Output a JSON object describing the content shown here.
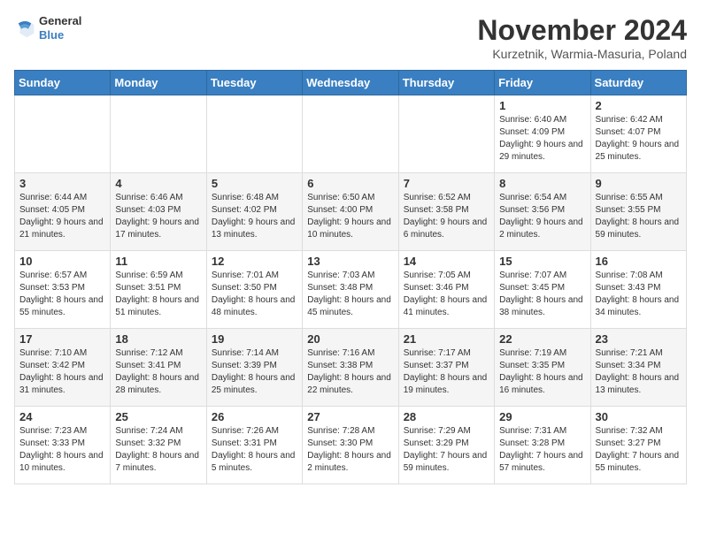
{
  "logo": {
    "line1": "General",
    "line2": "Blue"
  },
  "title": "November 2024",
  "location": "Kurzetnik, Warmia-Masuria, Poland",
  "weekdays": [
    "Sunday",
    "Monday",
    "Tuesday",
    "Wednesday",
    "Thursday",
    "Friday",
    "Saturday"
  ],
  "weeks": [
    [
      {
        "day": "",
        "info": ""
      },
      {
        "day": "",
        "info": ""
      },
      {
        "day": "",
        "info": ""
      },
      {
        "day": "",
        "info": ""
      },
      {
        "day": "",
        "info": ""
      },
      {
        "day": "1",
        "info": "Sunrise: 6:40 AM\nSunset: 4:09 PM\nDaylight: 9 hours and 29 minutes."
      },
      {
        "day": "2",
        "info": "Sunrise: 6:42 AM\nSunset: 4:07 PM\nDaylight: 9 hours and 25 minutes."
      }
    ],
    [
      {
        "day": "3",
        "info": "Sunrise: 6:44 AM\nSunset: 4:05 PM\nDaylight: 9 hours and 21 minutes."
      },
      {
        "day": "4",
        "info": "Sunrise: 6:46 AM\nSunset: 4:03 PM\nDaylight: 9 hours and 17 minutes."
      },
      {
        "day": "5",
        "info": "Sunrise: 6:48 AM\nSunset: 4:02 PM\nDaylight: 9 hours and 13 minutes."
      },
      {
        "day": "6",
        "info": "Sunrise: 6:50 AM\nSunset: 4:00 PM\nDaylight: 9 hours and 10 minutes."
      },
      {
        "day": "7",
        "info": "Sunrise: 6:52 AM\nSunset: 3:58 PM\nDaylight: 9 hours and 6 minutes."
      },
      {
        "day": "8",
        "info": "Sunrise: 6:54 AM\nSunset: 3:56 PM\nDaylight: 9 hours and 2 minutes."
      },
      {
        "day": "9",
        "info": "Sunrise: 6:55 AM\nSunset: 3:55 PM\nDaylight: 8 hours and 59 minutes."
      }
    ],
    [
      {
        "day": "10",
        "info": "Sunrise: 6:57 AM\nSunset: 3:53 PM\nDaylight: 8 hours and 55 minutes."
      },
      {
        "day": "11",
        "info": "Sunrise: 6:59 AM\nSunset: 3:51 PM\nDaylight: 8 hours and 51 minutes."
      },
      {
        "day": "12",
        "info": "Sunrise: 7:01 AM\nSunset: 3:50 PM\nDaylight: 8 hours and 48 minutes."
      },
      {
        "day": "13",
        "info": "Sunrise: 7:03 AM\nSunset: 3:48 PM\nDaylight: 8 hours and 45 minutes."
      },
      {
        "day": "14",
        "info": "Sunrise: 7:05 AM\nSunset: 3:46 PM\nDaylight: 8 hours and 41 minutes."
      },
      {
        "day": "15",
        "info": "Sunrise: 7:07 AM\nSunset: 3:45 PM\nDaylight: 8 hours and 38 minutes."
      },
      {
        "day": "16",
        "info": "Sunrise: 7:08 AM\nSunset: 3:43 PM\nDaylight: 8 hours and 34 minutes."
      }
    ],
    [
      {
        "day": "17",
        "info": "Sunrise: 7:10 AM\nSunset: 3:42 PM\nDaylight: 8 hours and 31 minutes."
      },
      {
        "day": "18",
        "info": "Sunrise: 7:12 AM\nSunset: 3:41 PM\nDaylight: 8 hours and 28 minutes."
      },
      {
        "day": "19",
        "info": "Sunrise: 7:14 AM\nSunset: 3:39 PM\nDaylight: 8 hours and 25 minutes."
      },
      {
        "day": "20",
        "info": "Sunrise: 7:16 AM\nSunset: 3:38 PM\nDaylight: 8 hours and 22 minutes."
      },
      {
        "day": "21",
        "info": "Sunrise: 7:17 AM\nSunset: 3:37 PM\nDaylight: 8 hours and 19 minutes."
      },
      {
        "day": "22",
        "info": "Sunrise: 7:19 AM\nSunset: 3:35 PM\nDaylight: 8 hours and 16 minutes."
      },
      {
        "day": "23",
        "info": "Sunrise: 7:21 AM\nSunset: 3:34 PM\nDaylight: 8 hours and 13 minutes."
      }
    ],
    [
      {
        "day": "24",
        "info": "Sunrise: 7:23 AM\nSunset: 3:33 PM\nDaylight: 8 hours and 10 minutes."
      },
      {
        "day": "25",
        "info": "Sunrise: 7:24 AM\nSunset: 3:32 PM\nDaylight: 8 hours and 7 minutes."
      },
      {
        "day": "26",
        "info": "Sunrise: 7:26 AM\nSunset: 3:31 PM\nDaylight: 8 hours and 5 minutes."
      },
      {
        "day": "27",
        "info": "Sunrise: 7:28 AM\nSunset: 3:30 PM\nDaylight: 8 hours and 2 minutes."
      },
      {
        "day": "28",
        "info": "Sunrise: 7:29 AM\nSunset: 3:29 PM\nDaylight: 7 hours and 59 minutes."
      },
      {
        "day": "29",
        "info": "Sunrise: 7:31 AM\nSunset: 3:28 PM\nDaylight: 7 hours and 57 minutes."
      },
      {
        "day": "30",
        "info": "Sunrise: 7:32 AM\nSunset: 3:27 PM\nDaylight: 7 hours and 55 minutes."
      }
    ]
  ]
}
